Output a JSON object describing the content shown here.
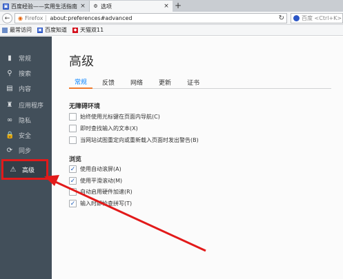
{
  "tabs": [
    {
      "label": "百度经验——实用生活指南",
      "icon": "baidu-icon"
    },
    {
      "label": "选项",
      "icon": "gear-icon"
    }
  ],
  "new_tab_label": "+",
  "tab_close_glyph": "×",
  "navbar": {
    "back_glyph": "←",
    "brand": "Firefox",
    "url": "about:preferences#advanced",
    "reload_glyph": "↻",
    "search_placeholder": "百度 <Ctrl+K>"
  },
  "bookmarks": [
    {
      "label": "最常访问",
      "icon": "folder-icon"
    },
    {
      "label": "百度知道",
      "icon": "baidu-icon"
    },
    {
      "label": "天猫双11",
      "icon": "tmall-icon"
    }
  ],
  "sidebar": {
    "items": [
      {
        "label": "常规",
        "icon": "general-icon",
        "glyph": "▮"
      },
      {
        "label": "搜索",
        "icon": "search-icon",
        "glyph": "⚲"
      },
      {
        "label": "内容",
        "icon": "content-icon",
        "glyph": "▤"
      },
      {
        "label": "应用程序",
        "icon": "applications-icon",
        "glyph": "♜"
      },
      {
        "label": "隐私",
        "icon": "privacy-icon",
        "glyph": "∞"
      },
      {
        "label": "安全",
        "icon": "security-icon",
        "glyph": "🔒"
      },
      {
        "label": "同步",
        "icon": "sync-icon",
        "glyph": "⟳"
      },
      {
        "label": "高级",
        "icon": "advanced-icon",
        "glyph": "⚠"
      }
    ],
    "selected": "高级"
  },
  "main": {
    "title": "高级",
    "tabs": [
      "常规",
      "反馈",
      "网络",
      "更新",
      "证书"
    ],
    "selected_tab": "常规",
    "accessibility": {
      "title": "无障碍环境",
      "options": [
        {
          "label": "始终使用光标键在页面内导航(C)",
          "checked": false
        },
        {
          "label": "即时查找输入的文本(X)",
          "checked": false
        },
        {
          "label": "当网站试图重定向或重新载入页面时发出警告(B)",
          "checked": false
        }
      ]
    },
    "browsing": {
      "title": "浏览",
      "options": [
        {
          "label": "使用自动滚屏(A)",
          "checked": true
        },
        {
          "label": "使用平滑滚动(M)",
          "checked": true
        },
        {
          "label": "自动启用硬件加速(R)",
          "checked": false
        },
        {
          "label": "输入时即检查拼写(T)",
          "checked": true
        }
      ]
    }
  },
  "colors": {
    "sidebar_bg": "#424f5a",
    "accent_blue": "#0a84ff",
    "tab_underline": "#f07a2b",
    "highlight_red": "#e21a1a"
  },
  "check_glyph": "✓"
}
